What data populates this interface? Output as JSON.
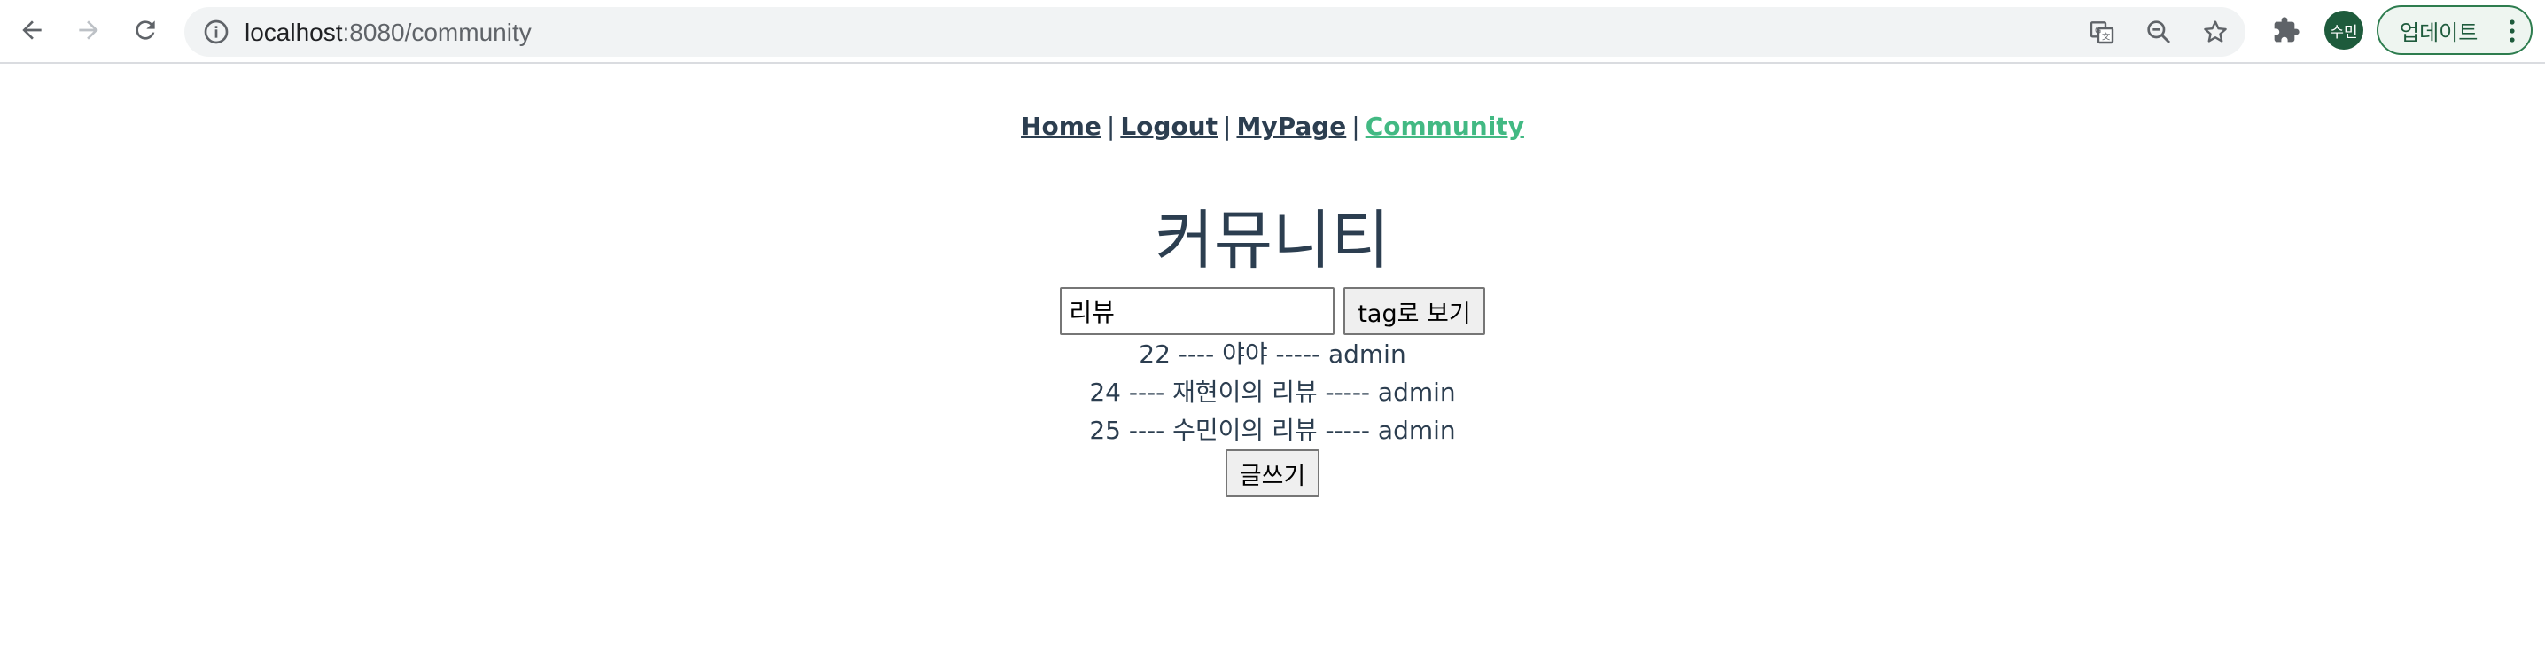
{
  "browser": {
    "url_host": "localhost",
    "url_path": ":8080/community",
    "profile_initials": "수민",
    "update_label": "업데이트",
    "icons": {
      "back": "arrow-left-icon",
      "forward": "arrow-right-icon",
      "reload": "reload-icon",
      "site_info": "info-icon",
      "translate": "translate-icon",
      "zoom": "zoom-out-icon",
      "bookmark": "star-icon",
      "extensions": "puzzle-icon",
      "menu": "more-vertical-icon"
    },
    "colors": {
      "profile_bg": "#1e5b3c",
      "update_border": "#2e7d4f"
    }
  },
  "nav": {
    "items": [
      {
        "label": "Home"
      },
      {
        "label": "Logout"
      },
      {
        "label": "MyPage"
      },
      {
        "label": "Community",
        "active": true
      }
    ],
    "separator": "|",
    "active_color": "#42b983",
    "text_color": "#2c3e50"
  },
  "page": {
    "title": "커뮤니티"
  },
  "search": {
    "value": "리뷰",
    "button_label": "tag로 보기"
  },
  "posts": [
    {
      "text": "22 ---- 야야 ----- admin"
    },
    {
      "text": "24 ---- 재현이의 리뷰 ----- admin"
    },
    {
      "text": "25 ---- 수민이의 리뷰 ----- admin"
    }
  ],
  "write_button_label": "글쓰기"
}
